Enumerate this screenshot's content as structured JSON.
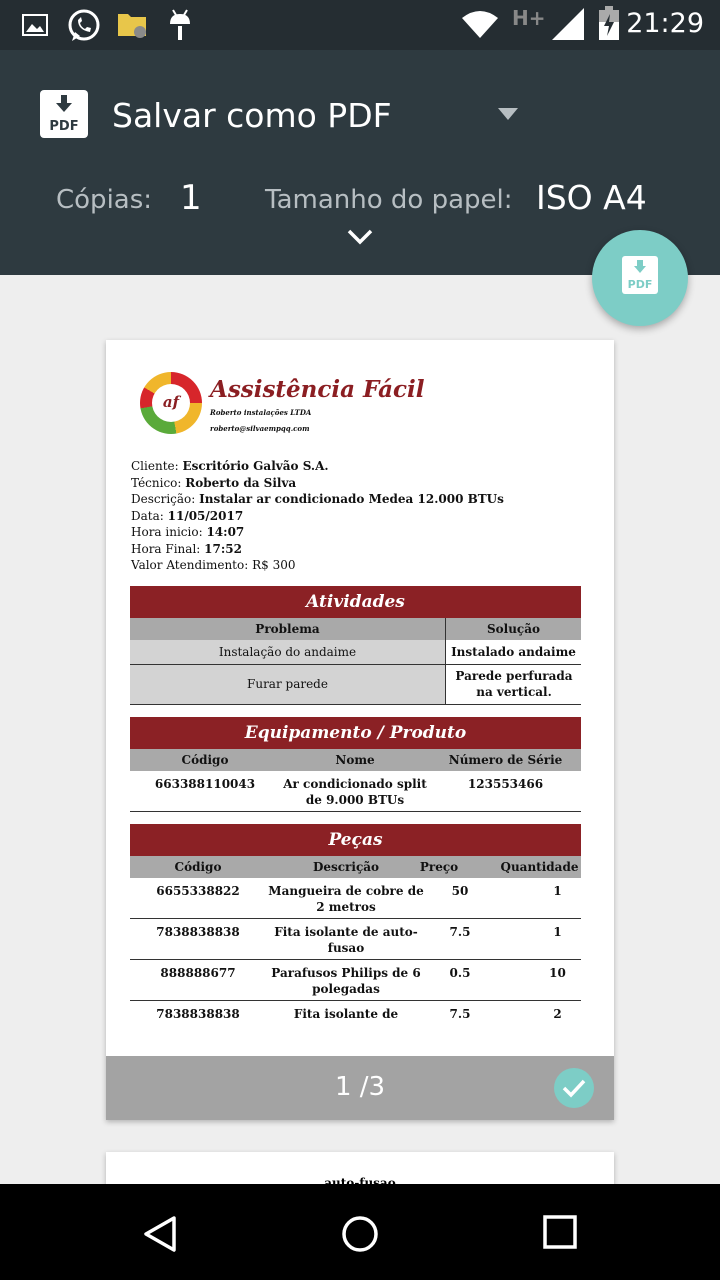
{
  "status_bar": {
    "time": "21:29",
    "network": "H+"
  },
  "header": {
    "destination": "Salvar como PDF",
    "pdf_icon_label": "PDF",
    "copies_label": "Cópias:",
    "copies_value": "1",
    "paper_label": "Tamanho do papel:",
    "paper_value": "ISO A4"
  },
  "fab": {
    "label": "PDF"
  },
  "document": {
    "brand": "Assistência Fácil",
    "logo_text": "af",
    "company": "Roberto instalações LTDA",
    "email": "roberto@silvaempqq.com",
    "info": [
      {
        "label": "Cliente:",
        "value": "Escritório Galvão S.A."
      },
      {
        "label": "Técnico:",
        "value": "Roberto da Silva"
      },
      {
        "label": "Descrição:",
        "value": "Instalar ar condicionado Medea 12.000 BTUs"
      },
      {
        "label": "Data:",
        "value": "11/05/2017"
      },
      {
        "label": "Hora inicio:",
        "value": "14:07"
      },
      {
        "label": "Hora Final:",
        "value": "17:52"
      },
      {
        "label": "Valor Atendimento:",
        "value": "R$ 300"
      }
    ],
    "atividades": {
      "title": "Atividades",
      "headers": [
        "Problema",
        "Solução"
      ],
      "rows": [
        [
          "Instalação do andaime",
          "Instalado andaime"
        ],
        [
          "Furar parede",
          "Parede perfurada na vertical."
        ]
      ]
    },
    "equipamento": {
      "title": "Equipamento / Produto",
      "headers": [
        "Código",
        "Nome",
        "Número de Série"
      ],
      "rows": [
        [
          "663388110043",
          "Ar condicionado split de 9.000 BTUs",
          "123553466"
        ]
      ]
    },
    "pecas": {
      "title": "Peças",
      "headers": [
        "Código",
        "Descrição",
        "Preço",
        "Quantidade"
      ],
      "rows": [
        [
          "6655338822",
          "Mangueira de cobre de 2 metros",
          "50",
          "1"
        ],
        [
          "7838838838",
          "Fita isolante de auto-fusao",
          "7.5",
          "1"
        ],
        [
          "888888677",
          "Parafusos Philips de 6 polegadas",
          "0.5",
          "10"
        ],
        [
          "7838838838",
          "Fita isolante de",
          "7.5",
          "2"
        ]
      ]
    },
    "page_indicator": "1 /3",
    "next_page_text": "auto-fusao"
  },
  "colors": {
    "toolbar": "#2e3a40",
    "statusbar": "#252d32",
    "accent": "#7dcdc6",
    "brand": "#8b1e22"
  }
}
